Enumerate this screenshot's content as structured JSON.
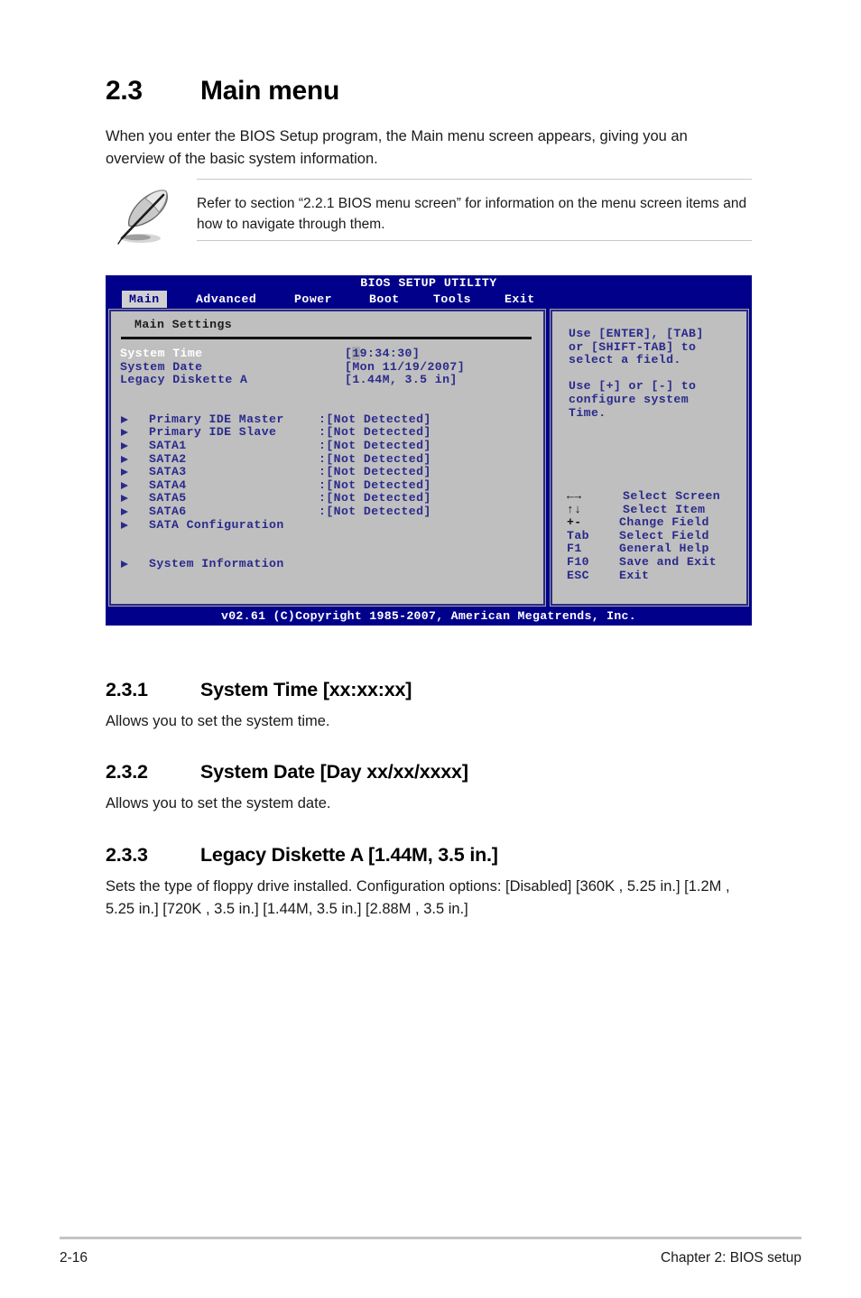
{
  "document": {
    "section_number": "2.3",
    "section_title": "Main menu",
    "intro": "When you enter the BIOS Setup program, the Main menu screen appears, giving you an overview of the basic system information.",
    "note": {
      "icon": "feather-pen-icon",
      "text": "Refer to section “2.2.1  BIOS menu screen” for information on the menu screen items and how to navigate through them."
    },
    "subsections": [
      {
        "number": "2.3.1",
        "title": "System Time [xx:xx:xx]",
        "body": "Allows you to set the system time."
      },
      {
        "number": "2.3.2",
        "title": "System Date [Day xx/xx/xxxx]",
        "body": "Allows you to set the system date."
      },
      {
        "number": "2.3.3",
        "title": "Legacy Diskette A [1.44M, 3.5 in.]",
        "body": "Sets the type of floppy drive installed. Configuration options: [Disabled] [360K , 5.25 in.] [1.2M , 5.25 in.] [720K , 3.5 in.] [1.44M, 3.5 in.] [2.88M , 3.5 in.]"
      }
    ],
    "footer": {
      "page_number": "2-16",
      "chapter": "Chapter 2: BIOS setup"
    }
  },
  "bios": {
    "title": "BIOS SETUP UTILITY",
    "tabs": [
      {
        "label": "Main",
        "active": true
      },
      {
        "label": "Advanced",
        "active": false
      },
      {
        "label": "Power",
        "active": false
      },
      {
        "label": "Boot",
        "active": false
      },
      {
        "label": "Tools",
        "active": false
      },
      {
        "label": "Exit",
        "active": false
      }
    ],
    "panel_header": "Main Settings",
    "fields": [
      {
        "label": "System Time",
        "value_pre": "[",
        "value_cursor": "1",
        "value_post": "9:34:30]",
        "selected": true
      },
      {
        "label": "System Date",
        "value": "[Mon 11/19/2007]",
        "selected": false
      },
      {
        "label": "Legacy Diskette A",
        "value": "[1.44M, 3.5 in]",
        "selected": false
      }
    ],
    "devices": [
      {
        "name": "Primary IDE Master",
        "value": ":[Not Detected]"
      },
      {
        "name": "Primary IDE Slave",
        "value": ":[Not Detected]"
      },
      {
        "name": "SATA1",
        "value": ":[Not Detected]"
      },
      {
        "name": "SATA2",
        "value": ":[Not Detected]"
      },
      {
        "name": "SATA3",
        "value": ":[Not Detected]"
      },
      {
        "name": "SATA4",
        "value": ":[Not Detected]"
      },
      {
        "name": "SATA5",
        "value": ":[Not Detected]"
      },
      {
        "name": "SATA6",
        "value": ":[Not Detected]"
      },
      {
        "name": "SATA Configuration",
        "value": ""
      }
    ],
    "extra_items": [
      {
        "name": "System Information",
        "value": ""
      }
    ],
    "help": {
      "paragraph1_line1": "Use [ENTER], [TAB]",
      "paragraph1_line2": "or [SHIFT-TAB] to",
      "paragraph1_line3": "select a field.",
      "paragraph2_line1": "Use [+] or [-] to",
      "paragraph2_line2": "configure system",
      "paragraph2_line3": "Time."
    },
    "keys": [
      {
        "key": "←→",
        "glyph": true,
        "desc": "Select Screen",
        "indent": true
      },
      {
        "key": "↑↓",
        "glyph": true,
        "desc": "Select Item",
        "indent": true
      },
      {
        "key": "+-",
        "glyph": true,
        "desc": "Change Field",
        "indent": false
      },
      {
        "key": "Tab",
        "glyph": false,
        "desc": "Select Field",
        "indent": false
      },
      {
        "key": "F1",
        "glyph": false,
        "desc": "General Help",
        "indent": false
      },
      {
        "key": "F10",
        "glyph": false,
        "desc": "Save and Exit",
        "indent": false
      },
      {
        "key": "ESC",
        "glyph": false,
        "desc": "Exit",
        "indent": false
      }
    ],
    "copyright": "v02.61 (C)Copyright 1985-2007, American Megatrends, Inc.",
    "colors": {
      "header_bg": "#00008b",
      "panel_bg": "#bfbfbf",
      "panel_border": "#2a2a8c",
      "text_blue": "#2a2a8c",
      "active_tab_bg": "#d0d0d0"
    }
  }
}
